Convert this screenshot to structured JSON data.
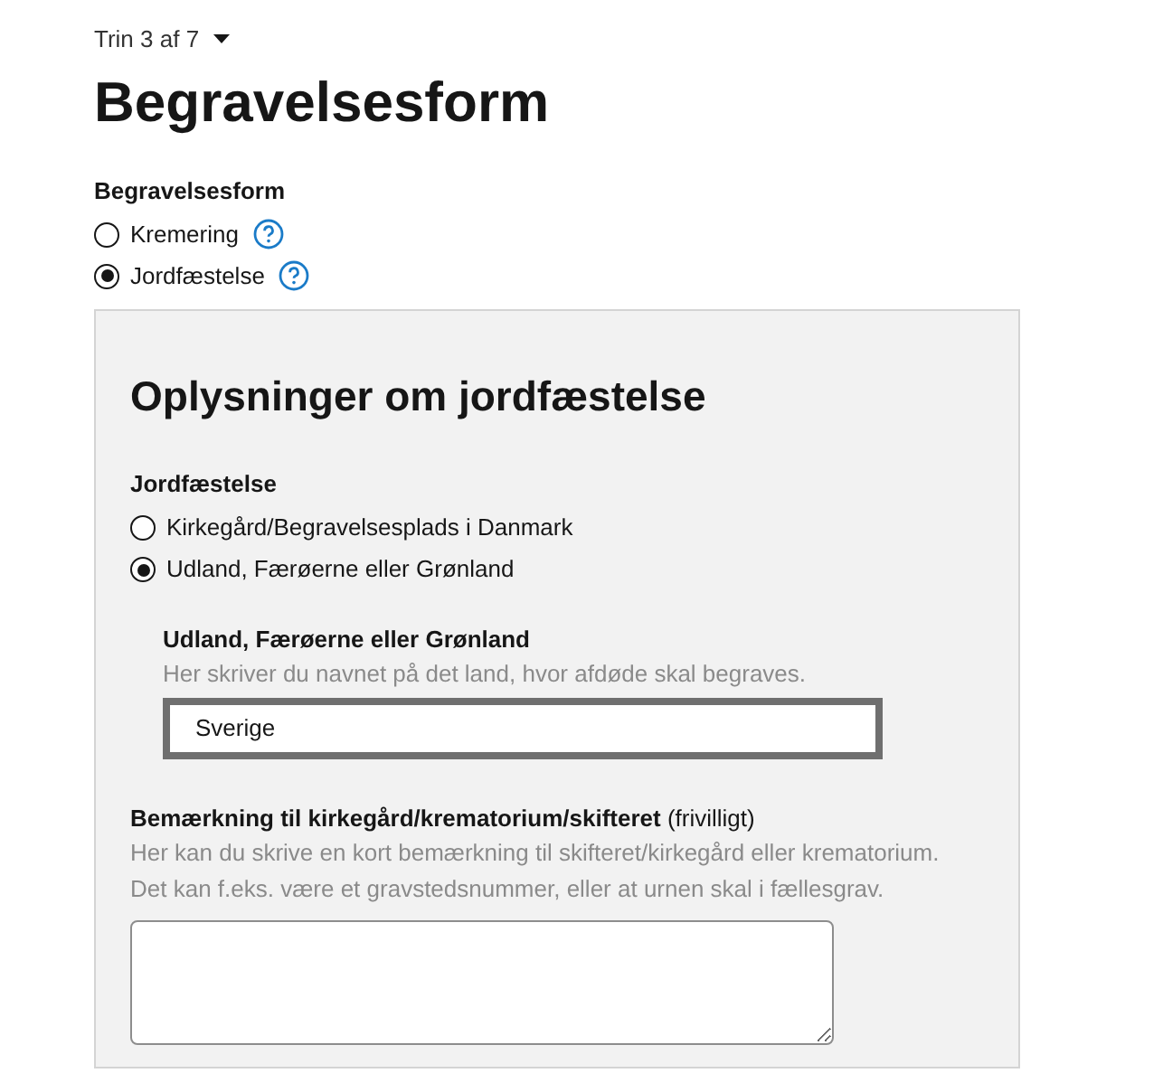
{
  "step": {
    "label": "Trin 3 af 7"
  },
  "title": "Begravelsesform",
  "burial_form": {
    "label": "Begravelsesform",
    "options": [
      {
        "label": "Kremering",
        "selected": false,
        "help": true
      },
      {
        "label": "Jordfæstelse",
        "selected": true,
        "help": true
      }
    ]
  },
  "panel": {
    "heading": "Oplysninger om jordfæstelse",
    "burial": {
      "label": "Jordfæstelse",
      "options": [
        {
          "label": "Kirkegård/Begravelsesplads i Danmark",
          "selected": false
        },
        {
          "label": "Udland, Færøerne eller Grønland",
          "selected": true
        }
      ]
    },
    "country": {
      "label": "Udland, Færøerne eller Grønland",
      "hint": "Her skriver du navnet på det land, hvor afdøde skal begraves.",
      "value": "Sverige"
    },
    "remark": {
      "label": "**Bemærkning til kirkegård/krematorium/skifteret** (frivilligt)",
      "hint_lines": [
        "Her kan du skrive en kort bemærkning til skifteret/kirkegård eller krematorium.",
        "Det kan f.eks. være et gravstedsnummer, eller at urnen skal i fællesgrav."
      ]
    }
  }
}
